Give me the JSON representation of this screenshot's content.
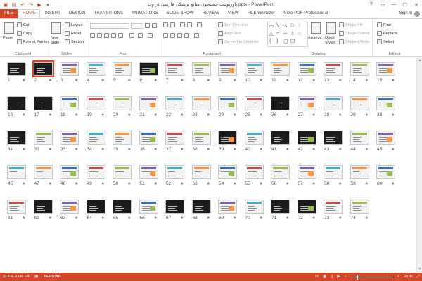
{
  "titlebar": {
    "title": "پاورپوینت جستجوی منابع پزشکی فارسی در وب.pptx - PowerPoint",
    "qat_icons": [
      "save-icon",
      "undo-icon",
      "redo-icon",
      "start-from-beginning-icon",
      "customize-qat-icon"
    ],
    "window_buttons": [
      "?",
      "▭",
      "—",
      "☐",
      "✕"
    ]
  },
  "tabs": {
    "file": "FILE",
    "items": [
      "HOME",
      "INSERT",
      "DESIGN",
      "TRANSITIONS",
      "ANIMATIONS",
      "SLIDE SHOW",
      "REVIEW",
      "VIEW",
      "FILEminimizer",
      "Nitro PDF Professional"
    ],
    "active": "HOME",
    "signin": "Sign in"
  },
  "ribbon": {
    "clipboard": {
      "label": "Clipboard",
      "paste": "Paste",
      "cut": "Cut",
      "copy": "Copy",
      "format_painter": "Format Painter"
    },
    "slides": {
      "label": "Slides",
      "new_slide": "New",
      "new_slide2": "Slide",
      "layout": "Layout",
      "reset": "Reset",
      "section": "Section"
    },
    "font": {
      "label": "Font"
    },
    "paragraph": {
      "label": "Paragraph",
      "text_direction": "Text Direction",
      "align_text": "Align Text",
      "convert_smartart": "Convert to SmartArt"
    },
    "drawing": {
      "label": "Drawing",
      "arrange": "Arrange",
      "quick_styles": "Quick",
      "quick_styles2": "Styles",
      "shape_fill": "Shape Fill",
      "shape_outline": "Shape Outline",
      "shape_effects": "Shape Effects"
    },
    "editing": {
      "label": "Editing",
      "find": "Find",
      "replace": "Replace",
      "select": "Select"
    }
  },
  "slides": {
    "total": 74,
    "selected": 2,
    "star": "★",
    "dark_slides": [
      1,
      2,
      6,
      16,
      17,
      26,
      31,
      39,
      41,
      42,
      43,
      62,
      64,
      65,
      67,
      68,
      71,
      72
    ]
  },
  "status": {
    "slide_info": "SLIDE 2 OF 74",
    "language": "PERSIAN",
    "zoom_value": "20 %",
    "zoom_minus": "−",
    "zoom_plus": "+"
  }
}
